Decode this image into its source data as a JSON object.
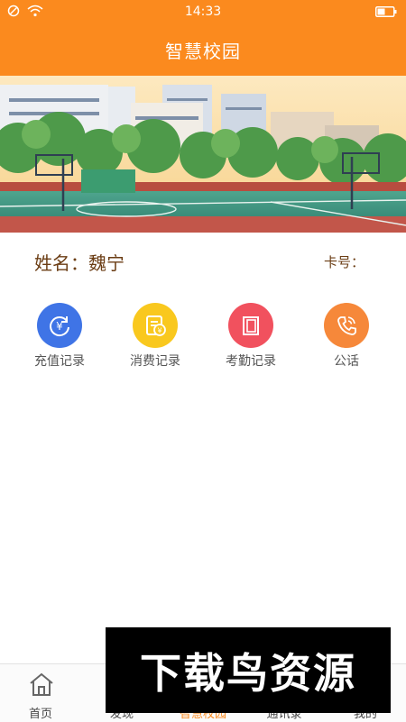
{
  "status_bar": {
    "time": "14:33",
    "icons": [
      "blocked-icon",
      "wifi-icon",
      "battery-icon"
    ]
  },
  "header": {
    "title": "智慧校园"
  },
  "banner": {
    "description_icon": "school-scene-illustration"
  },
  "profile": {
    "name_label": "姓名：魏宁",
    "card_label": "卡号："
  },
  "menu": [
    {
      "label": "充值记录",
      "icon": "recharge-icon",
      "color": "#3f74e6"
    },
    {
      "label": "消费记录",
      "icon": "receipt-icon",
      "color": "#f9c81e"
    },
    {
      "label": "考勤记录",
      "icon": "attendance-icon",
      "color": "#f1515e"
    },
    {
      "label": "公话",
      "icon": "phone-icon",
      "color": "#f6883a"
    }
  ],
  "tabbar": [
    {
      "label": "首页",
      "icon": "home-icon",
      "active": false
    },
    {
      "label": "发现",
      "icon": "discover-icon",
      "active": false
    },
    {
      "label": "智慧校园",
      "icon": "campus-icon",
      "active": true
    },
    {
      "label": "通讯录",
      "icon": "contacts-icon",
      "active": false
    },
    {
      "label": "我的",
      "icon": "profile-icon",
      "active": false
    }
  ],
  "watermark": {
    "text": "下载鸟资源"
  },
  "colors": {
    "accent": "#fb8a1e",
    "name_text": "#6b3d14"
  }
}
